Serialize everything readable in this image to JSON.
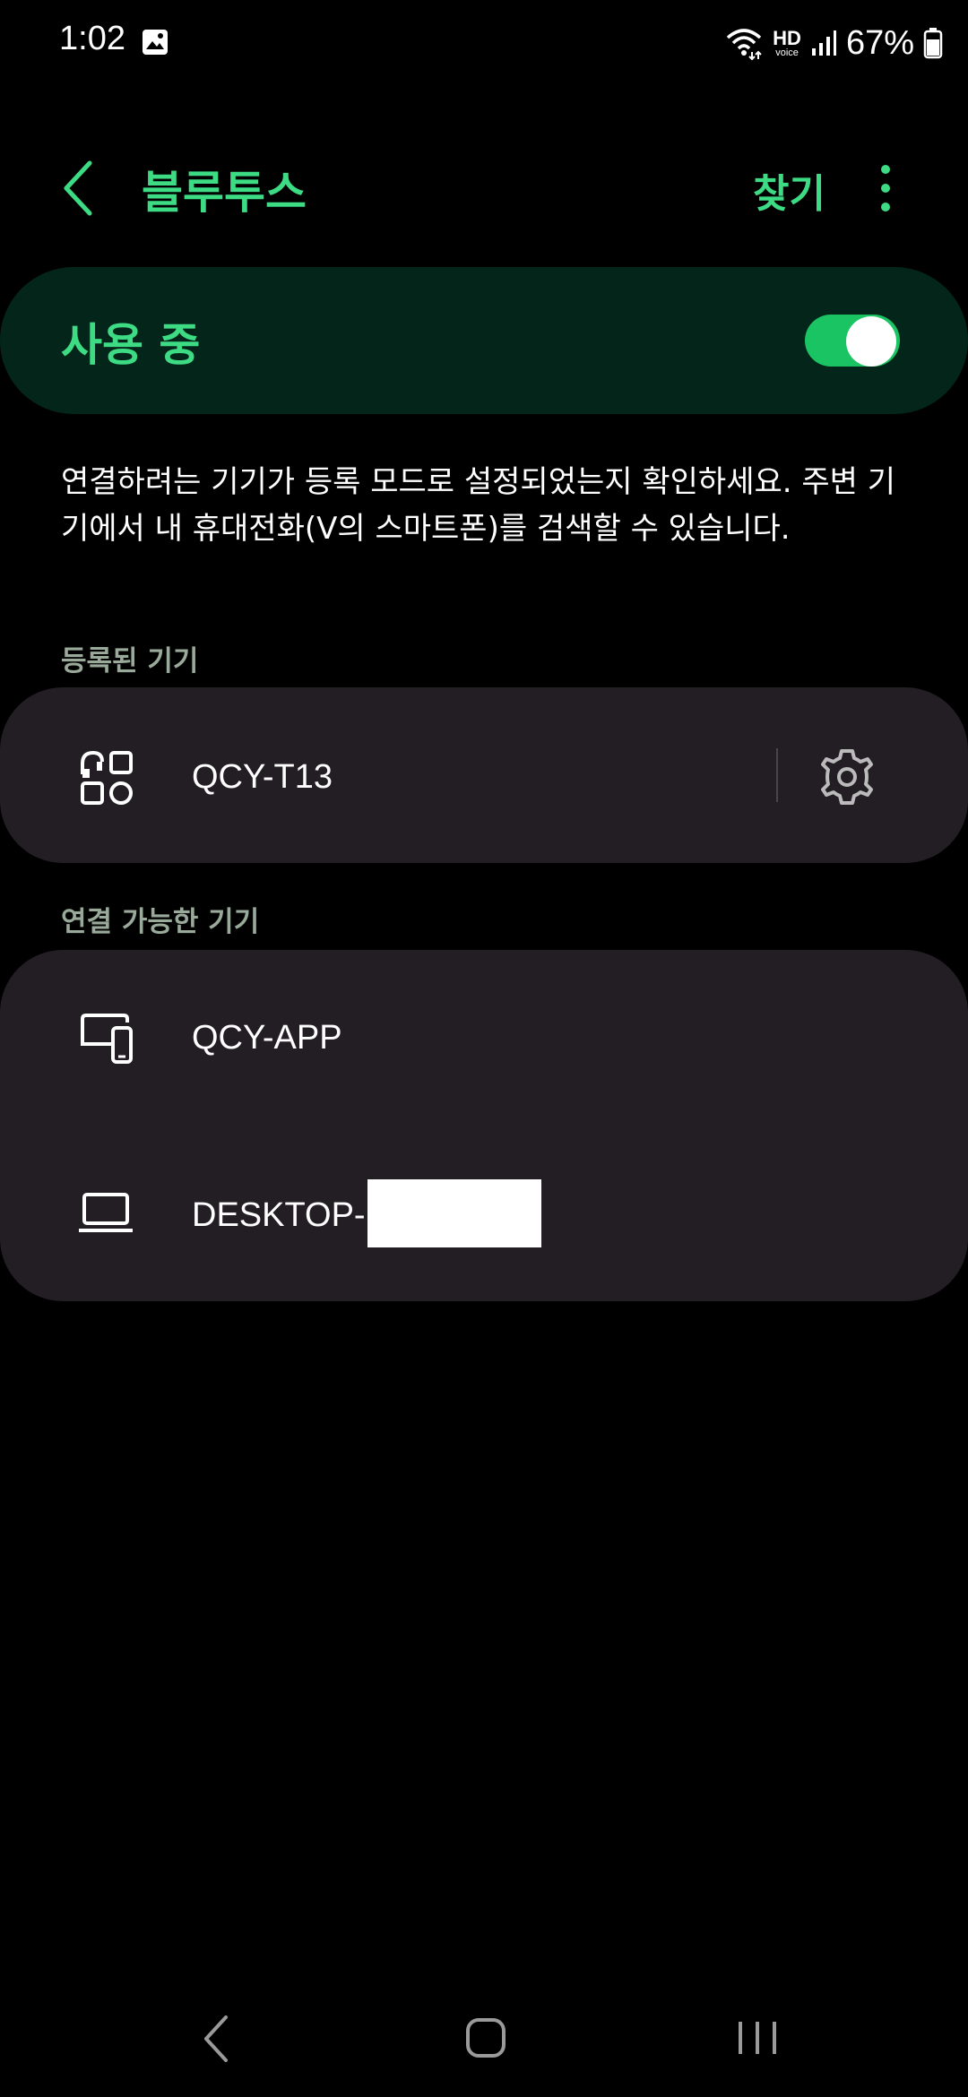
{
  "status_bar": {
    "time": "1:02",
    "gallery_icon": "image-icon",
    "wifi_icon": "wifi-icon",
    "hd_voice_label": "HD",
    "hd_voice_sub": "voice",
    "signal_icon": "signal-icon",
    "battery_percent": "67%",
    "battery_icon": "battery-icon"
  },
  "header": {
    "back_icon": "chevron-left-icon",
    "title": "블루투스",
    "search_label": "찾기",
    "more_icon": "more-vert-icon"
  },
  "master_toggle": {
    "label": "사용 중",
    "on": true
  },
  "description": "연결하려는 기기가 등록 모드로 설정되었는지 확인하세요. 주변 기기에서 내 휴대전화(V의 스마트폰)를 검색할 수 있습니다.",
  "registered_devices": {
    "header": "등록된 기기",
    "items": [
      {
        "name": "QCY-T13",
        "icon": "earbuds-icon",
        "settings_icon": "gear-icon"
      }
    ]
  },
  "available_devices": {
    "header": "연결 가능한 기기",
    "items": [
      {
        "name": "QCY-APP",
        "icon": "devices-icon"
      },
      {
        "name": "DESKTOP-",
        "icon": "laptop-icon"
      }
    ]
  },
  "nav_bar": {
    "back_icon": "nav-back-icon",
    "home_icon": "nav-home-icon",
    "recents_icon": "nav-recents-icon"
  },
  "colors": {
    "accent": "#3ddc84",
    "toggle_on": "#1ac463",
    "card": "#231e24",
    "toggle_card": "#04261a"
  }
}
